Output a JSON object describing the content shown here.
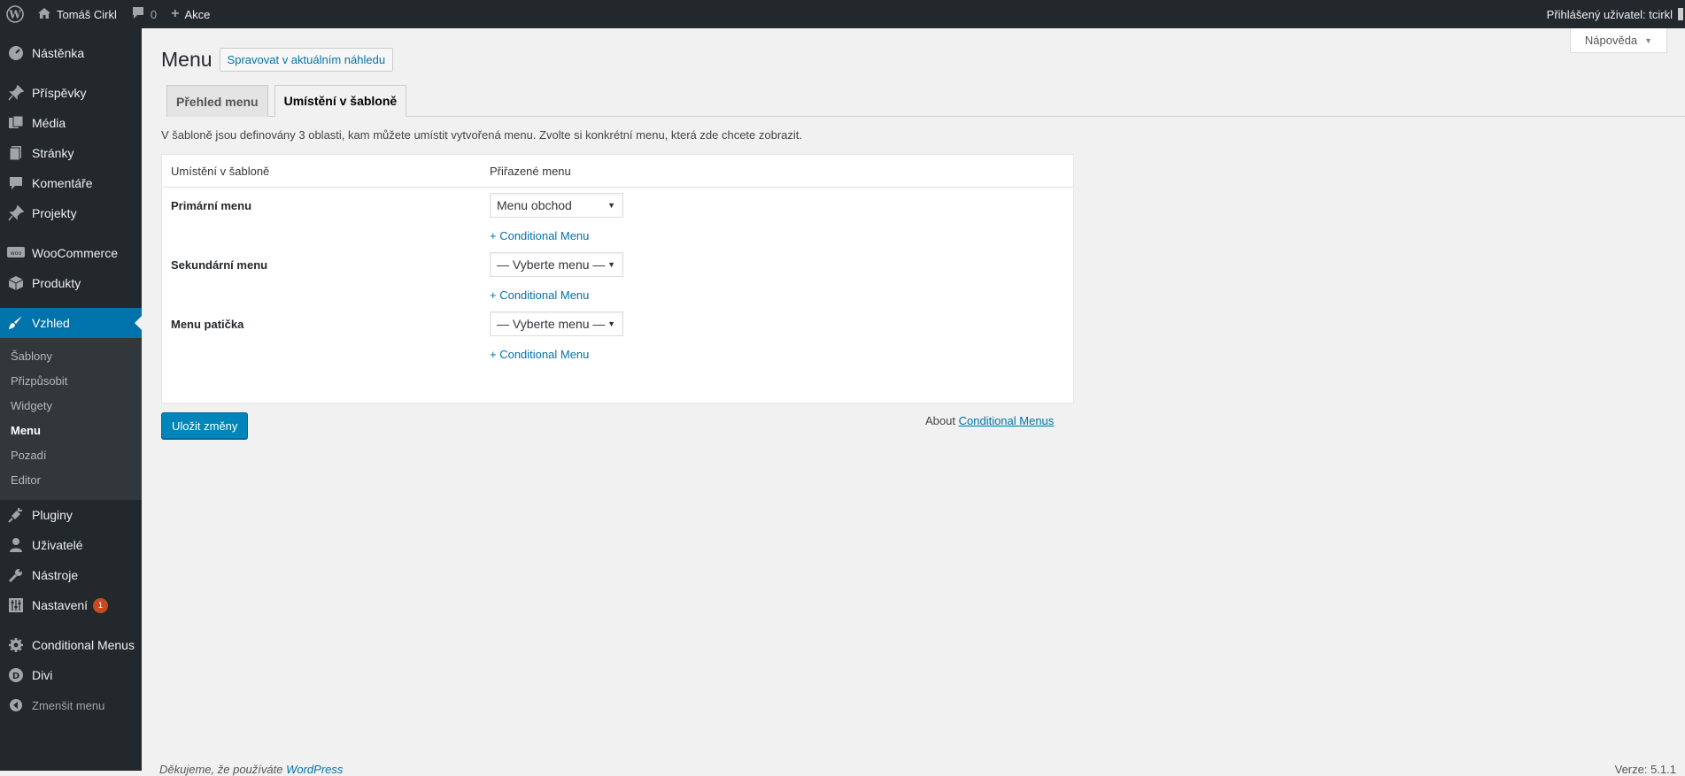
{
  "adminbar": {
    "site_name": "Tomáš Cirkl",
    "comments_count": "0",
    "new_label": "Akce",
    "user_greeting": "Přihlášený uživatel: tcirkl"
  },
  "sidebar": {
    "items": [
      {
        "label": "Nástěnka"
      },
      {
        "label": "Příspěvky"
      },
      {
        "label": "Média"
      },
      {
        "label": "Stránky"
      },
      {
        "label": "Komentáře"
      },
      {
        "label": "Projekty"
      },
      {
        "label": "WooCommerce"
      },
      {
        "label": "Produkty"
      },
      {
        "label": "Vzhled"
      },
      {
        "label": "Pluginy"
      },
      {
        "label": "Uživatelé"
      },
      {
        "label": "Nástroje"
      },
      {
        "label": "Nastavení",
        "badge": "1"
      },
      {
        "label": "Conditional Menus"
      },
      {
        "label": "Divi"
      },
      {
        "label": "Zmenšit menu"
      }
    ],
    "submenu": [
      "Šablony",
      "Přizpůsobit",
      "Widgety",
      "Menu",
      "Pozadí",
      "Editor"
    ]
  },
  "header": {
    "help_label": "Nápověda",
    "title": "Menu",
    "preview_button": "Spravovat v aktuálním náhledu"
  },
  "tabs": [
    {
      "label": "Přehled menu"
    },
    {
      "label": "Umístění v šabloně"
    }
  ],
  "description": "V šabloně jsou definovány 3 oblasti, kam můžete umístit vytvořená menu. Zvolte si konkrétní menu, která zde chcete zobrazit.",
  "table": {
    "col_location": "Umístění v šabloně",
    "col_assigned": "Přiřazené menu",
    "rows": [
      {
        "label": "Primární menu",
        "selected": "Menu obchod",
        "link": "+ Conditional Menu"
      },
      {
        "label": "Sekundární menu",
        "selected": "— Vyberte menu —",
        "link": "+ Conditional Menu"
      },
      {
        "label": "Menu patička",
        "selected": "— Vyberte menu —",
        "link": "+ Conditional Menu"
      }
    ]
  },
  "save_button": "Uložit změny",
  "about": {
    "prefix": "About",
    "link": "Conditional Menus"
  },
  "footer": {
    "thanks_prefix": "Děkujeme, že používáte",
    "thanks_link": "WordPress",
    "version": "Verze: 5.1.1"
  }
}
